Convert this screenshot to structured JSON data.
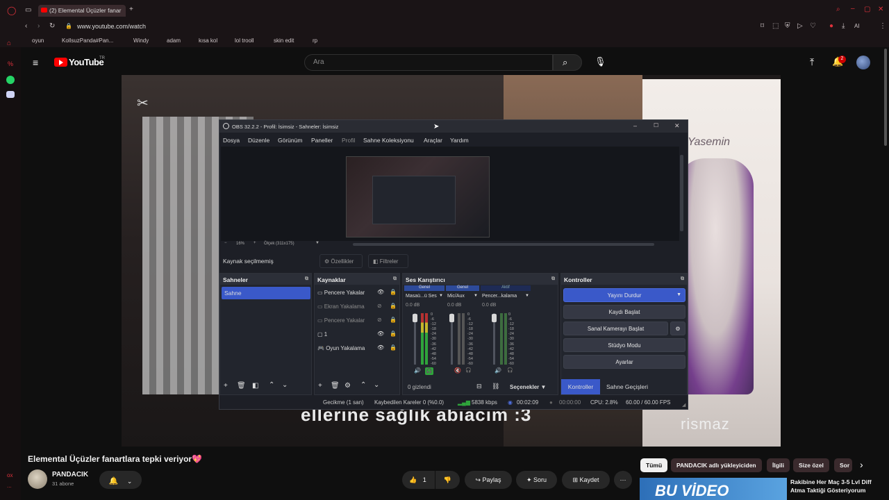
{
  "browser": {
    "tab_title": "(2) Elemental Üçüzler fanar",
    "url": "www.youtube.com/watch",
    "ai_label": "AI",
    "bookmarks": [
      "oyun",
      "KollsuzPanda#Pan...",
      "Windy",
      "adam",
      "kısa kol",
      "lol trooll",
      "skin edit",
      "rp"
    ],
    "sidebar_labels": [
      "%",
      "ox",
      "..."
    ]
  },
  "youtube": {
    "logo_text": "YouTube",
    "region": "TR",
    "search_placeholder": "Ara",
    "notification_count": "2",
    "video_title": "Elemental Üçüzler fanartlara tepki veriyor💖",
    "channel_name": "PANDACIK",
    "subscribers": "31 abone",
    "like_count": "1",
    "share_label": "Paylaş",
    "ask_label": "Soru",
    "save_label": "Kaydet",
    "chips": [
      "Tümü",
      "PANDACIK adlı yükleyiciden",
      "İlgili",
      "Size özel",
      "Sor"
    ],
    "recommended_title": "Rakibine Her Maç 3-5 Lvl Diff Atma Taktiği Gösteriyorum",
    "recommended_thumb_text": "BU VİDEO",
    "subtitle_overlay": "ellerine sağlık abiacım :3",
    "overlay_text_1": "Yasemin",
    "overlay_text_2": "rismaz"
  },
  "obs": {
    "title": "OBS 32.2.2 - Profil: İsimsiz - Sahneler: İsimsiz",
    "menu": [
      "Dosya",
      "Düzenle",
      "Görünüm",
      "Paneller",
      "Profil",
      "Sahne Koleksiyonu",
      "Araçlar",
      "Yardım"
    ],
    "zoom": "16%",
    "scale_label": "Ölçek (311x175)",
    "no_source": "Kaynak seçilmemiş",
    "properties": "Özellikler",
    "filters": "Filtreler",
    "scenes_header": "Sahneler",
    "scenes": [
      "Sahne"
    ],
    "sources_header": "Kaynaklar",
    "sources": [
      {
        "name": "Pencere Yakalar",
        "visible": true
      },
      {
        "name": "Ekran Yakalama",
        "visible": false
      },
      {
        "name": "Pencere Yakalar",
        "visible": false
      },
      {
        "name": "1",
        "visible": true
      },
      {
        "name": "Oyun Yakalama",
        "visible": true
      }
    ],
    "mixer_header": "Ses Karıştırıcı",
    "mixer_channels": [
      {
        "tag": "Genel",
        "name": "Masaü...ü Ses",
        "db": "0.0 dB"
      },
      {
        "tag": "Genel",
        "name": "Mic/Aux",
        "db": "0.0 dB"
      },
      {
        "tag": "Aktif",
        "name": "Pencer...kalama",
        "db": "0.0 dB"
      }
    ],
    "meter_ticks": [
      "0",
      "-6",
      "-12",
      "-18",
      "-24",
      "-30",
      "-36",
      "-42",
      "-48",
      "-54",
      "-60"
    ],
    "hidden_count": "0 gizlendi",
    "options": "Seçenekler",
    "controls_header": "Kontroller",
    "controls": [
      "Yayını Durdur",
      "Kaydı Başlat",
      "Sanal Kamerayı Başlat",
      "Stüdyo Modu",
      "Ayarlar"
    ],
    "bottom_tabs": [
      "Kontroller",
      "Sahne Geçişleri"
    ],
    "status": {
      "delay": "Gecikme (1 san)",
      "dropped": "Kaybedilen Kareler 0 (%0.0)",
      "bitrate": "5838 kbps",
      "stream_time": "00:02:09",
      "rec_time": "00:00:00",
      "cpu": "CPU: 2.8%",
      "fps": "60.00 / 60.00 FPS"
    }
  },
  "colors": {
    "accent_blue": "#3a59c9",
    "youtube_red": "#ff0000",
    "opera_red": "#e0323c"
  }
}
